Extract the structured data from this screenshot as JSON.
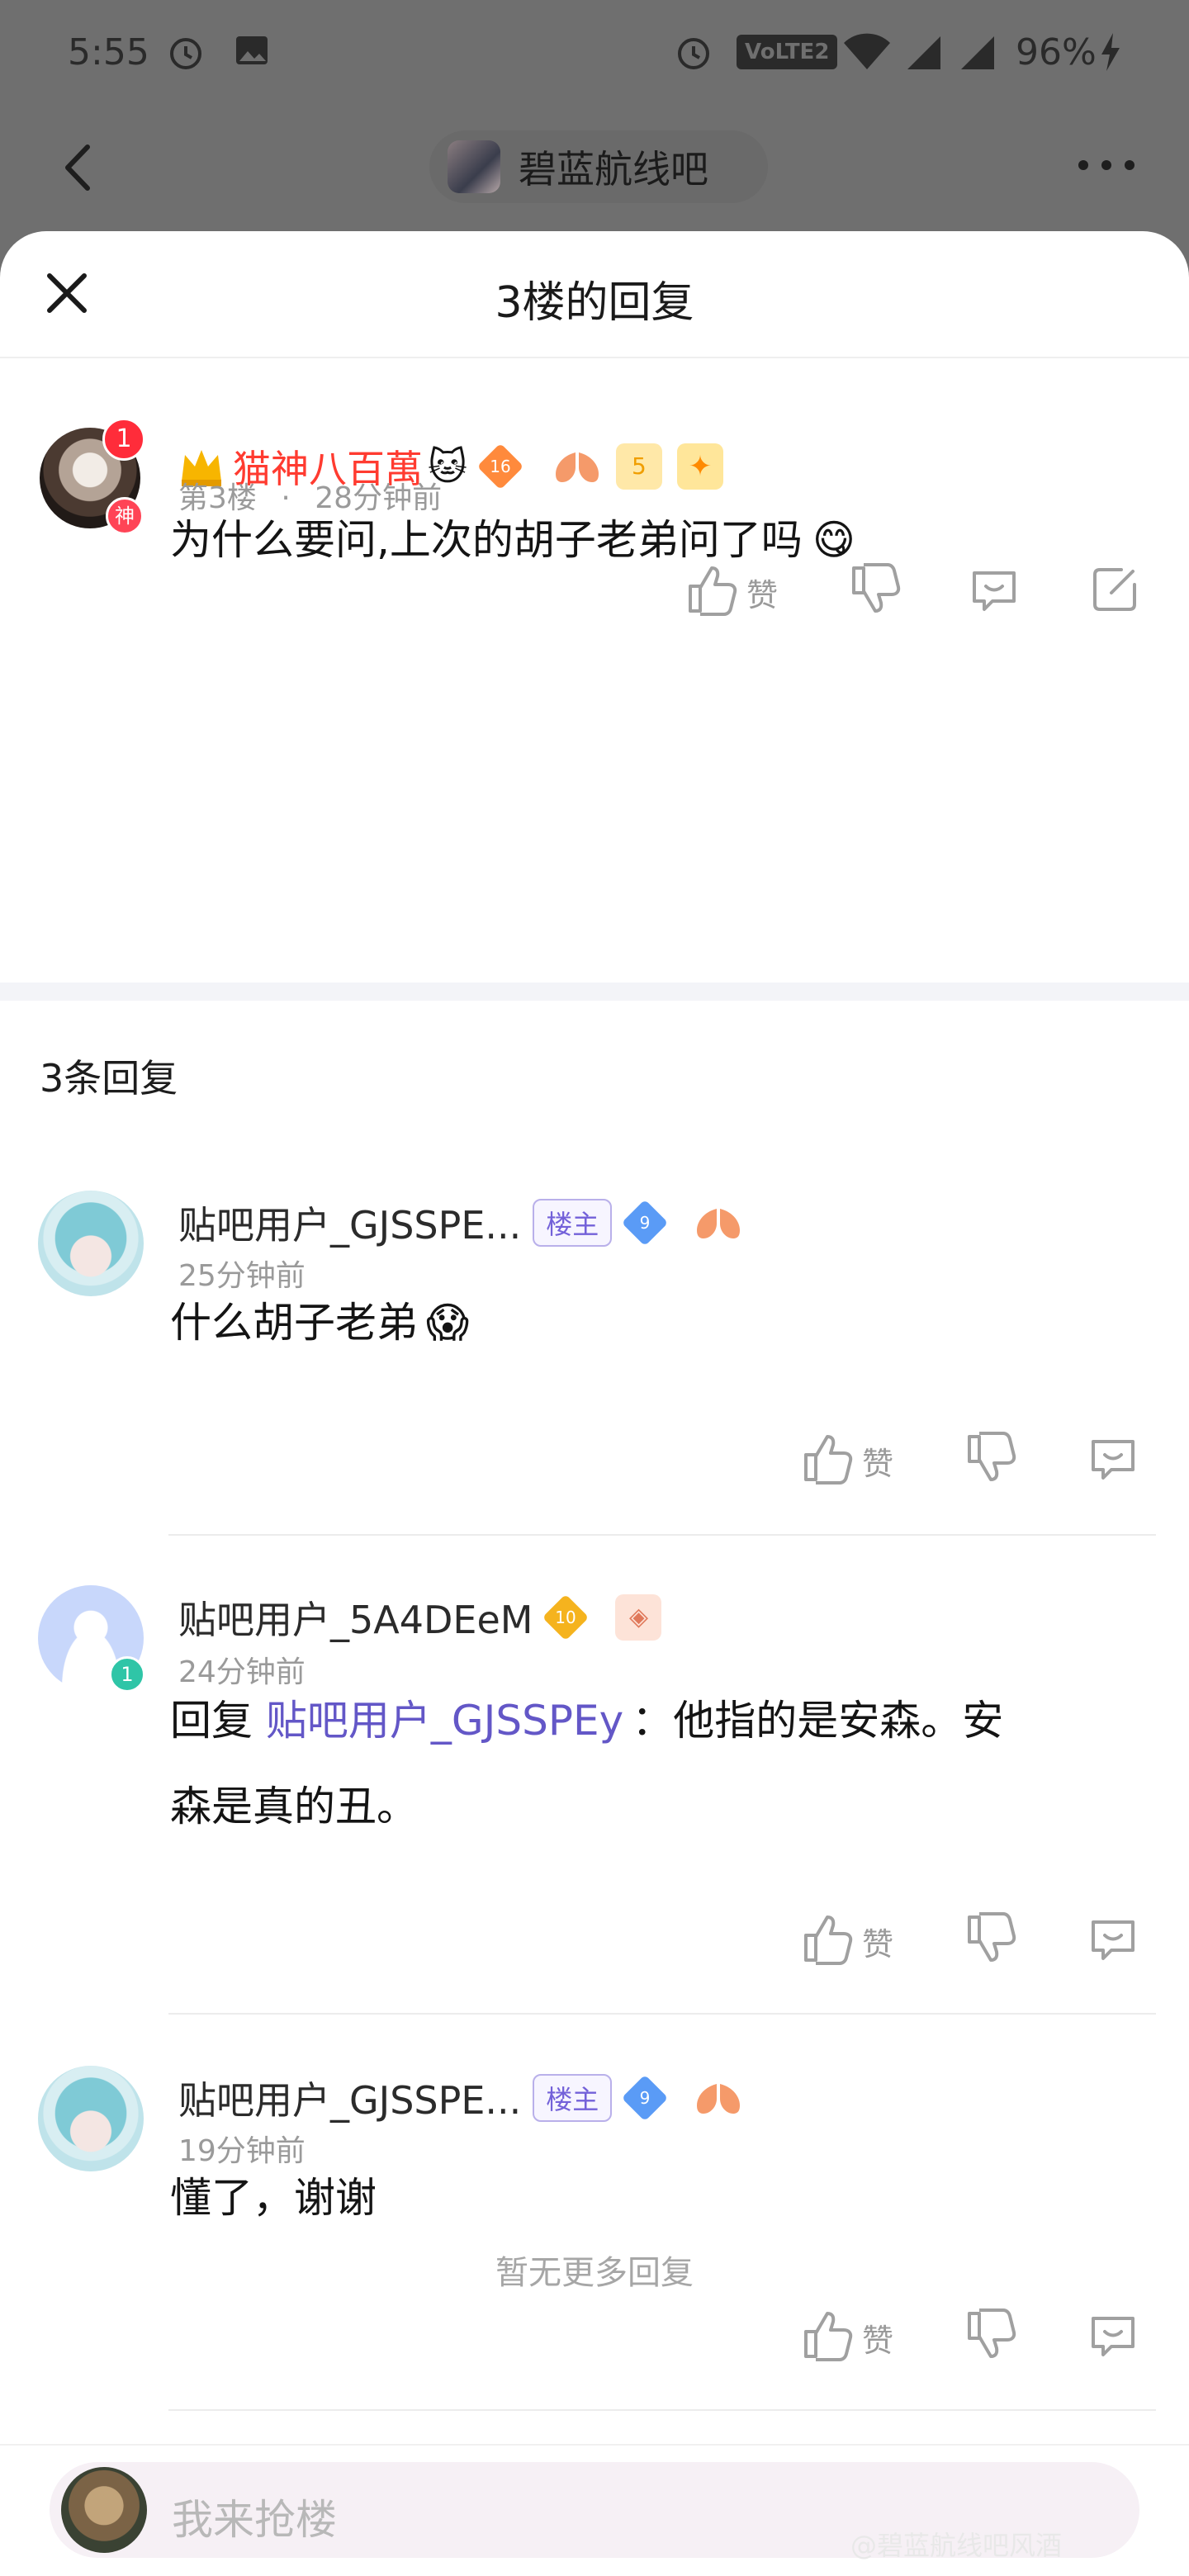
{
  "status_bar": {
    "time": "5:55",
    "network": "VoLTE2",
    "battery": "96%"
  },
  "forum": {
    "name": "碧蓝航线吧"
  },
  "sheet": {
    "title": "3楼的回复"
  },
  "main_post": {
    "author": "猫神八百萬",
    "author_emoji": "🐱",
    "level": "16",
    "sub_level": "5",
    "notification_count": "1",
    "god_badge": "神",
    "floor": "第3楼",
    "separator": "·",
    "time": "28分钟前",
    "content": "为什么要问,上次的胡子老弟问了吗",
    "content_emoji": "😋",
    "like_label": "赞"
  },
  "reply_count": "3条回复",
  "replies": [
    {
      "author": "贴吧用户_GJSSPE...",
      "tag": "楼主",
      "level": "9",
      "time": "25分钟前",
      "content": "什么胡子老弟",
      "content_emoji": "😱",
      "like_label": "赞"
    },
    {
      "author": "贴吧用户_5A4DEeM",
      "level": "10",
      "badge": "1",
      "time": "24分钟前",
      "reply_prefix": "回复 ",
      "reply_target": "贴吧用户_GJSSPEy",
      "content_line1": "：他指的是安森。安",
      "content_line2": "森是真的丑。",
      "like_label": "赞"
    },
    {
      "author": "贴吧用户_GJSSPE...",
      "tag": "楼主",
      "level": "9",
      "time": "19分钟前",
      "content": "懂了，谢谢",
      "like_label": "赞"
    }
  ],
  "no_more": "暂无更多回复",
  "input": {
    "placeholder": "我来抢楼"
  },
  "watermark": "@碧蓝航线吧风酒"
}
